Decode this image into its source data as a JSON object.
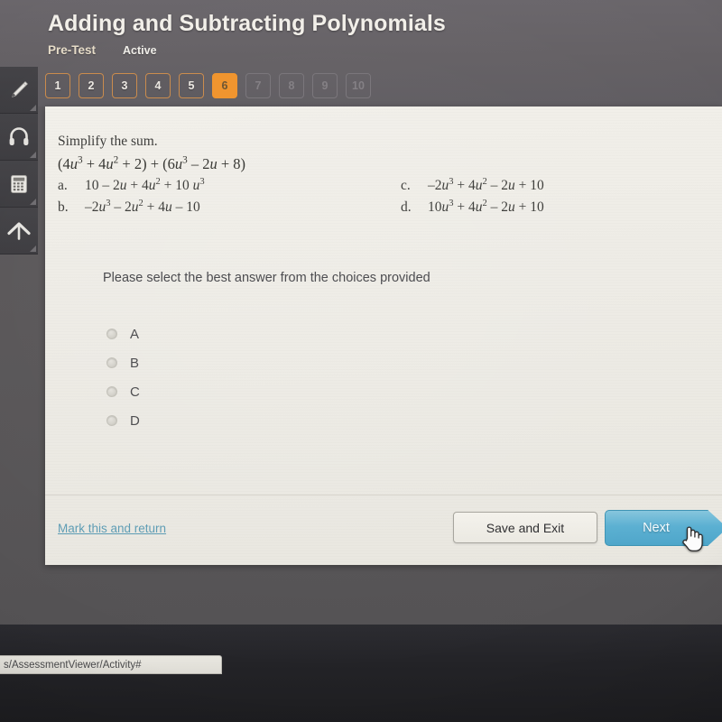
{
  "header": {
    "title": "Adding and Subtracting Polynomials",
    "test_type": "Pre-Test",
    "status": "Active",
    "accent_color": "#f0932b",
    "pager": [
      {
        "label": "1",
        "state": "done"
      },
      {
        "label": "2",
        "state": "done"
      },
      {
        "label": "3",
        "state": "done"
      },
      {
        "label": "4",
        "state": "done"
      },
      {
        "label": "5",
        "state": "done"
      },
      {
        "label": "6",
        "state": "current"
      },
      {
        "label": "7",
        "state": "locked"
      },
      {
        "label": "8",
        "state": "locked"
      },
      {
        "label": "9",
        "state": "locked"
      },
      {
        "label": "10",
        "state": "locked"
      }
    ]
  },
  "toolbar": {
    "items": [
      {
        "icon": "pencil-icon"
      },
      {
        "icon": "headphones-icon"
      },
      {
        "icon": "calculator-icon"
      },
      {
        "icon": "up-arrow-icon"
      }
    ]
  },
  "question": {
    "prompt": "Simplify the sum.",
    "expression": "(4u3 + 4u2 + 2) + (6u3 – 2u + 8)",
    "choices": [
      {
        "letter": "a.",
        "text": "10 – 2u + 4u2 + 10 u3"
      },
      {
        "letter": "b.",
        "text": "–2u3 – 2u2 + 4u – 10"
      },
      {
        "letter": "c.",
        "text": "–2u3 + 4u2 – 2u + 10"
      },
      {
        "letter": "d.",
        "text": "10u3 + 4u2 – 2u + 10"
      }
    ],
    "instruction": "Please select the best answer from the choices provided",
    "options": [
      {
        "label": "A",
        "selected": false
      },
      {
        "label": "B",
        "selected": false
      },
      {
        "label": "C",
        "selected": false
      },
      {
        "label": "D",
        "selected": false
      }
    ]
  },
  "footer": {
    "mark_link": "Mark this and return",
    "save_label": "Save and Exit",
    "next_label": "Next",
    "next_color": "#5bb0d2"
  },
  "browser": {
    "status_url": "s/AssessmentViewer/Activity#"
  }
}
